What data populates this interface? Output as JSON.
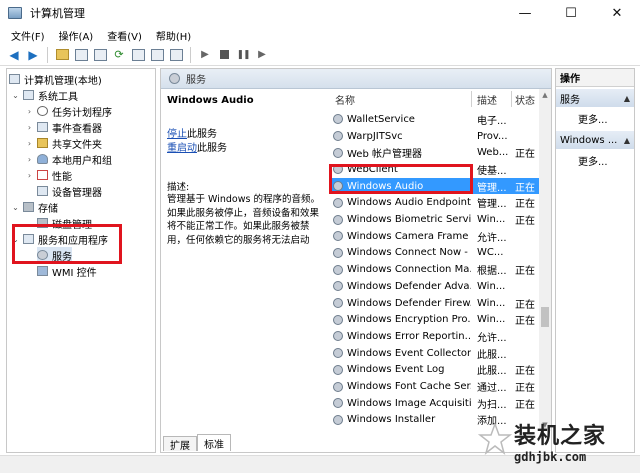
{
  "window": {
    "title": "计算机管理",
    "minimize": "—",
    "maximize": "☐",
    "close": "✕"
  },
  "menu": [
    "文件(F)",
    "操作(A)",
    "查看(V)",
    "帮助(H)"
  ],
  "tree": {
    "root": "计算机管理(本地)",
    "system_tools": "系统工具",
    "task_scheduler": "任务计划程序",
    "event_viewer": "事件查看器",
    "shared_folders": "共享文件夹",
    "local_users": "本地用户和组",
    "performance": "性能",
    "device_manager": "设备管理器",
    "storage": "存储",
    "disk_management": "磁盘管理",
    "services_apps": "服务和应用程序",
    "services": "服务",
    "wmi": "WMI 控件"
  },
  "middle": {
    "header": "服务",
    "selected_name": "Windows Audio",
    "stop_link": "停止",
    "stop_suffix": "此服务",
    "restart_link": "重启动",
    "restart_suffix": "此服务",
    "desc_label": "描述:",
    "desc_text": "管理基于 Windows 的程序的音频。如果此服务被停止，音频设备和效果将不能正常工作。如果此服务被禁用，任何依赖它的服务将无法启动",
    "columns": {
      "name": "名称",
      "desc": "描述",
      "status": "状态"
    },
    "tabs": [
      "扩展",
      "标准"
    ]
  },
  "services": [
    {
      "name": "WalletService",
      "desc": "电子...",
      "status": ""
    },
    {
      "name": "WarpJITSvc",
      "desc": "Prov...",
      "status": ""
    },
    {
      "name": "Web 帐户管理器",
      "desc": "Web...",
      "status": "正在"
    },
    {
      "name": "WebClient",
      "desc": "使基...",
      "status": ""
    },
    {
      "name": "Windows Audio",
      "desc": "管理...",
      "status": "正在"
    },
    {
      "name": "Windows Audio Endpoint...",
      "desc": "管理...",
      "status": "正在"
    },
    {
      "name": "Windows Biometric Servi...",
      "desc": "Win...",
      "status": "正在"
    },
    {
      "name": "Windows Camera Frame ...",
      "desc": "允许...",
      "status": ""
    },
    {
      "name": "Windows Connect Now - ...",
      "desc": "WC...",
      "status": ""
    },
    {
      "name": "Windows Connection Ma...",
      "desc": "根据...",
      "status": "正在"
    },
    {
      "name": "Windows Defender Adva...",
      "desc": "Win...",
      "status": ""
    },
    {
      "name": "Windows Defender Firew...",
      "desc": "Win...",
      "status": "正在"
    },
    {
      "name": "Windows Encryption Pro...",
      "desc": "Win...",
      "status": "正在"
    },
    {
      "name": "Windows Error Reportin...",
      "desc": "允许...",
      "status": ""
    },
    {
      "name": "Windows Event Collector",
      "desc": "此服...",
      "status": ""
    },
    {
      "name": "Windows Event Log",
      "desc": "此服...",
      "status": "正在"
    },
    {
      "name": "Windows Font Cache Ser...",
      "desc": "通过...",
      "status": "正在"
    },
    {
      "name": "Windows Image Acquisiti...",
      "desc": "为扫...",
      "status": "正在"
    },
    {
      "name": "Windows Installer",
      "desc": "添加...",
      "status": ""
    }
  ],
  "actions": {
    "header": "操作",
    "group1": "服务",
    "group2": "Windows ...",
    "more": "更多..."
  },
  "watermark": {
    "cn": "装机之家",
    "url": "gdhjbk.com"
  },
  "colors": {
    "selection": "#3399ff",
    "highlight": "#e0141e",
    "link": "#1a4fb4"
  }
}
